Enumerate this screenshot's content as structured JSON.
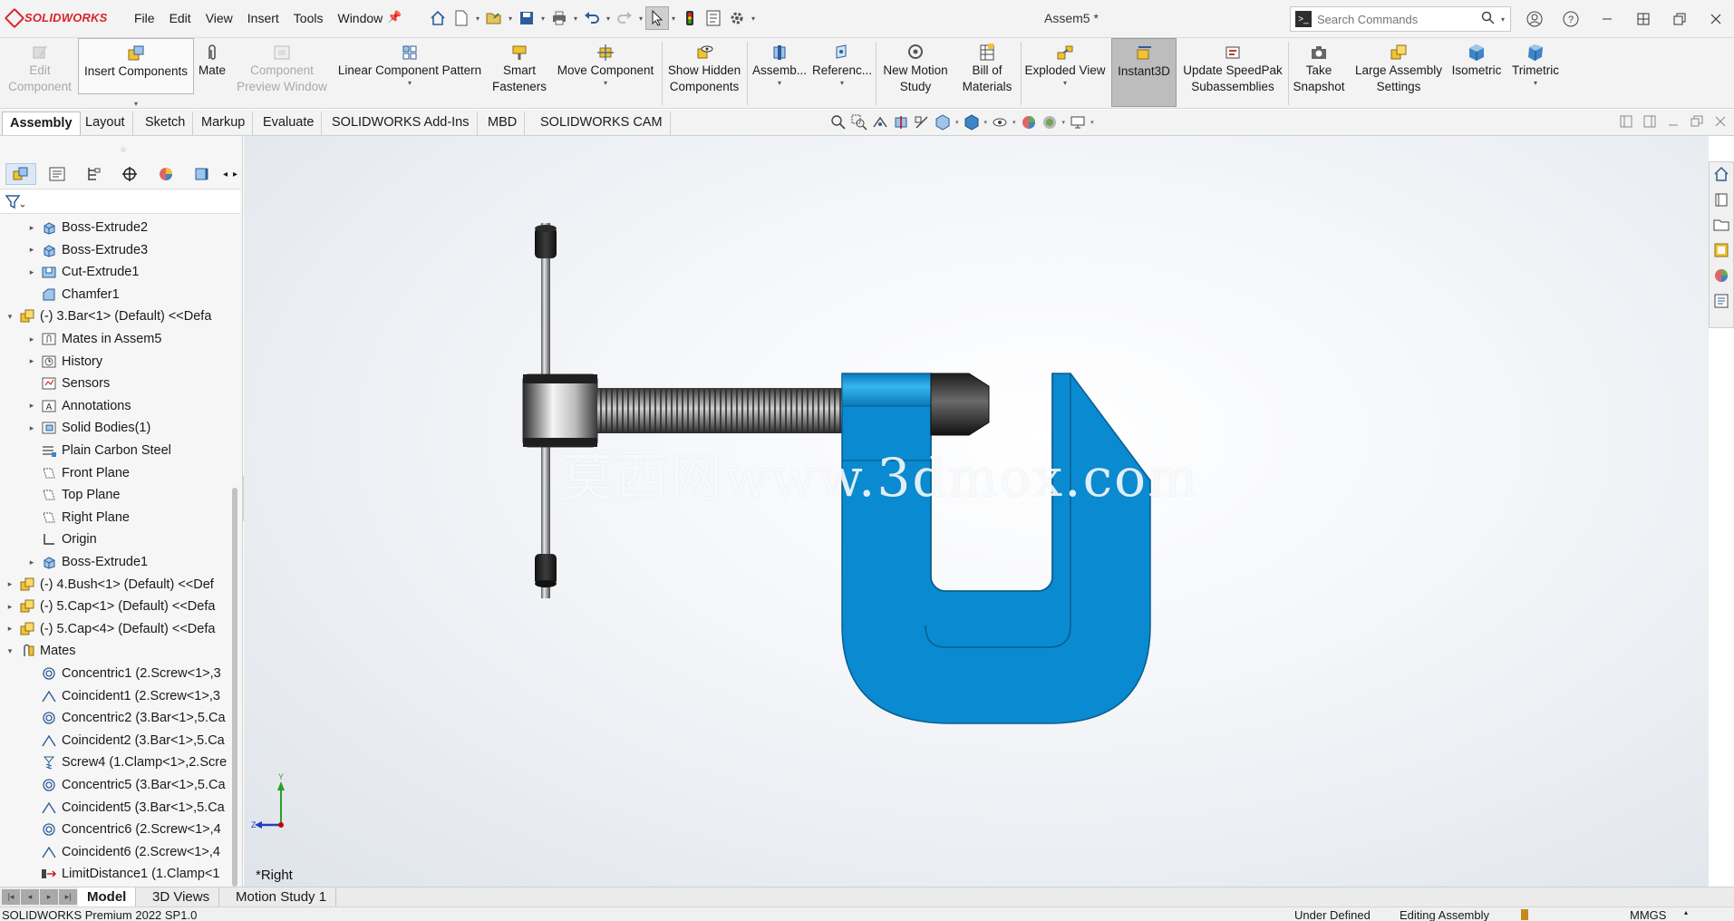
{
  "app": {
    "brand": "SOLIDWORKS",
    "document_title": "Assem5 *"
  },
  "menu": [
    "File",
    "Edit",
    "View",
    "Insert",
    "Tools",
    "Window"
  ],
  "search": {
    "placeholder": "Search Commands"
  },
  "commands": {
    "edit_component": "Edit Component",
    "insert_components": "Insert Components",
    "mate": "Mate",
    "component_preview_window": "Component Preview Window",
    "linear_component_pattern": "Linear Component Pattern",
    "smart_fasteners": "Smart Fasteners",
    "move_component": "Move Component",
    "show_hidden_components": "Show Hidden Components",
    "assembly": "Assemb...",
    "reference": "Referenc...",
    "new_motion_study": "New Motion Study",
    "bill_of_materials": "Bill of Materials",
    "exploded_view": "Exploded View",
    "instant3d": "Instant3D",
    "update_speedpak": "Update SpeedPak Subassemblies",
    "take_snapshot": "Take Snapshot",
    "large_assembly_settings": "Large Assembly Settings",
    "isometric": "Isometric",
    "trimetric": "Trimetric"
  },
  "tabs": [
    "Assembly",
    "Layout",
    "Sketch",
    "Markup",
    "Evaluate",
    "SOLIDWORKS Add-Ins",
    "MBD",
    "SOLIDWORKS CAM"
  ],
  "tree": [
    {
      "label": "Boss-Extrude2",
      "icon": "extrude-icon",
      "expand": "▸"
    },
    {
      "label": "Boss-Extrude3",
      "icon": "extrude-icon",
      "expand": "▸"
    },
    {
      "label": "Cut-Extrude1",
      "icon": "cut-extrude-icon",
      "expand": "▸"
    },
    {
      "label": "Chamfer1",
      "icon": "chamfer-icon",
      "expand": ""
    },
    {
      "label": "(-) 3.Bar<1> (Default) <<Defa",
      "icon": "part-icon",
      "expand": "▾"
    },
    {
      "label": "Mates in Assem5",
      "icon": "mates-folder-icon",
      "expand": "▸"
    },
    {
      "label": "History",
      "icon": "history-icon",
      "expand": "▸"
    },
    {
      "label": "Sensors",
      "icon": "sensors-icon",
      "expand": ""
    },
    {
      "label": "Annotations",
      "icon": "annotations-icon",
      "expand": "▸"
    },
    {
      "label": "Solid Bodies(1)",
      "icon": "solid-bodies-icon",
      "expand": "▸"
    },
    {
      "label": "Plain Carbon Steel",
      "icon": "material-icon",
      "expand": ""
    },
    {
      "label": "Front Plane",
      "icon": "plane-icon",
      "expand": ""
    },
    {
      "label": "Top Plane",
      "icon": "plane-icon",
      "expand": ""
    },
    {
      "label": "Right Plane",
      "icon": "plane-icon",
      "expand": ""
    },
    {
      "label": "Origin",
      "icon": "origin-icon",
      "expand": ""
    },
    {
      "label": "Boss-Extrude1",
      "icon": "extrude-icon",
      "expand": "▸"
    },
    {
      "label": "(-) 4.Bush<1> (Default) <<Def",
      "icon": "part-icon",
      "expand": "▸"
    },
    {
      "label": "(-) 5.Cap<1> (Default) <<Defa",
      "icon": "part-icon",
      "expand": "▸"
    },
    {
      "label": "(-) 5.Cap<4> (Default) <<Defa",
      "icon": "part-icon",
      "expand": "▸"
    },
    {
      "label": "Mates",
      "icon": "mates-icon",
      "expand": "▾"
    },
    {
      "label": "Concentric1 (2.Screw<1>,3",
      "icon": "concentric-icon",
      "expand": ""
    },
    {
      "label": "Coincident1 (2.Screw<1>,3",
      "icon": "coincident-icon",
      "expand": ""
    },
    {
      "label": "Concentric2 (3.Bar<1>,5.Ca",
      "icon": "concentric-icon",
      "expand": ""
    },
    {
      "label": "Coincident2 (3.Bar<1>,5.Ca",
      "icon": "coincident-icon",
      "expand": ""
    },
    {
      "label": "Screw4 (1.Clamp<1>,2.Scre",
      "icon": "screw-mate-icon",
      "expand": ""
    },
    {
      "label": "Concentric5 (3.Bar<1>,5.Ca",
      "icon": "concentric-icon",
      "expand": ""
    },
    {
      "label": "Coincident5 (3.Bar<1>,5.Ca",
      "icon": "coincident-icon",
      "expand": ""
    },
    {
      "label": "Concentric6 (2.Screw<1>,4",
      "icon": "concentric-icon",
      "expand": ""
    },
    {
      "label": "Coincident6 (2.Screw<1>,4",
      "icon": "coincident-icon",
      "expand": ""
    },
    {
      "label": "LimitDistance1 (1.Clamp<1",
      "icon": "limit-distance-icon",
      "expand": ""
    }
  ],
  "viewport": {
    "view_name": "*Right",
    "watermark": "莫西网www.3dmox.com",
    "triad": {
      "y": "Y",
      "z": "Z"
    }
  },
  "bottom_tabs": [
    "Model",
    "3D Views",
    "Motion Study 1"
  ],
  "status": {
    "version": "SOLIDWORKS Premium 2022 SP1.0",
    "definition": "Under Defined",
    "mode": "Editing Assembly",
    "units": "MMGS"
  },
  "colors": {
    "clamp_blue": "#0a8ad0",
    "brand_red": "#d9242b"
  }
}
